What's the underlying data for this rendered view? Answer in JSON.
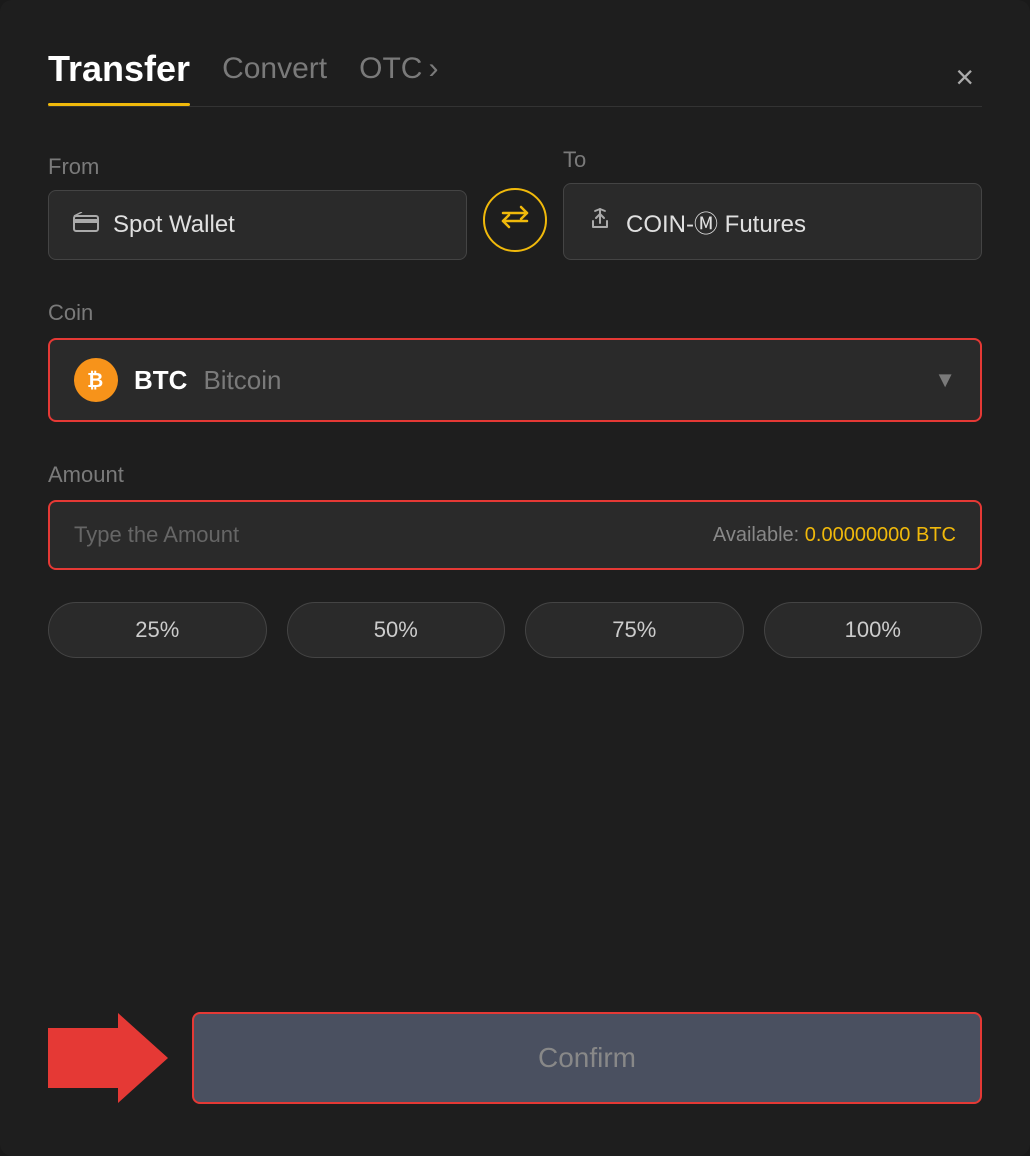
{
  "header": {
    "tab_transfer": "Transfer",
    "tab_convert": "Convert",
    "tab_otc": "OTC",
    "close_label": "×"
  },
  "from": {
    "label": "From",
    "wallet": "Spot Wallet",
    "wallet_icon": "💳"
  },
  "to": {
    "label": "To",
    "wallet": "COIN-Ⓜ Futures",
    "wallet_icon": "↑"
  },
  "swap": {
    "icon": "⇄"
  },
  "coin": {
    "label": "Coin",
    "symbol": "BTC",
    "name": "Bitcoin",
    "icon": "₿"
  },
  "amount": {
    "label": "Amount",
    "placeholder": "Type the Amount",
    "available_label": "Available:",
    "available_value": "0.00000000 BTC"
  },
  "percentages": [
    {
      "label": "25%",
      "value": 25
    },
    {
      "label": "50%",
      "value": 50
    },
    {
      "label": "75%",
      "value": 75
    },
    {
      "label": "100%",
      "value": 100
    }
  ],
  "confirm": {
    "label": "Confirm"
  }
}
